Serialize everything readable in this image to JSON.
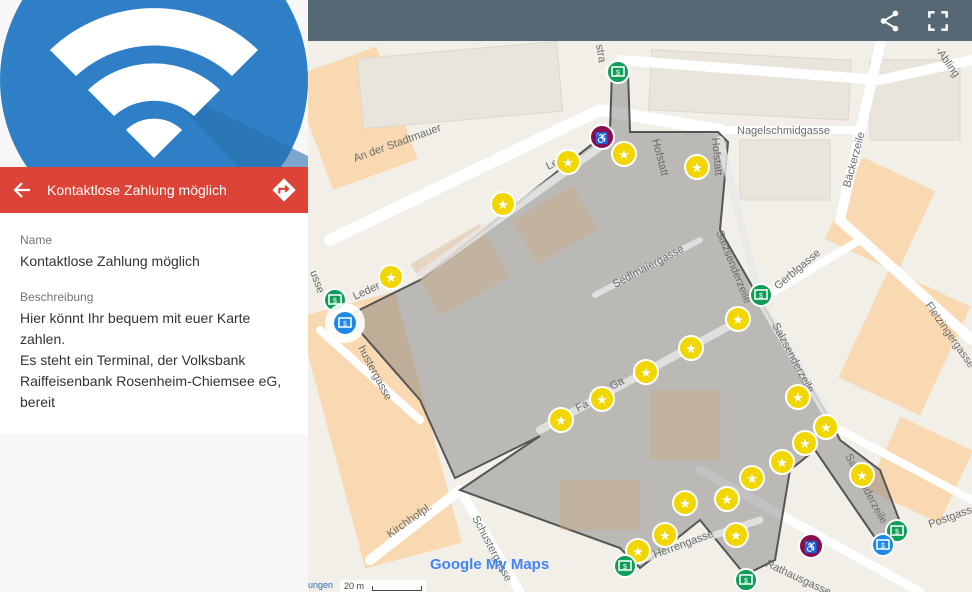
{
  "panel": {
    "title": "Kontaktlose Zahlung möglich",
    "name_label": "Name",
    "name_value": "Kontaktlose Zahlung möglich",
    "description_label": "Beschreibung",
    "description_lines": [
      "Hier könnt Ihr bequem mit euer Karte",
      "zahlen.",
      "Es steht ein Terminal, der Volksbank",
      "Raiffeisenbank Rosenheim-Chiemsee eG,",
      "bereit"
    ]
  },
  "map": {
    "streets": {
      "an_der_stadtmauer": "An der Stadtmauer",
      "nagelschmidgasse": "Nagelschmidgasse",
      "baeckerzeile": "Bäckerzeile",
      "hofstatt": "Hofstatt",
      "sedlmaiergasse": "Sedlmaiergasse",
      "salzsenderzeile": "Salzsenderzeile",
      "gerblgasse": "Gerblgasse",
      "fletzingergasse": "Fletzingergasse",
      "kirchhofpl": "Kirchhofpl.",
      "schustergasse": "Schustergasse",
      "herrengasse": "Herrengasse",
      "rathausgasse": "Rathausgasse",
      "postgasse": "Postgasse",
      "abling": "-Abling",
      "ledererzeile_partial": "Leder",
      "fall_partial": "Fa",
      "usse_partial": "usse",
      "ehustergasse": "hustergasse",
      "lederzeile_top": "Le",
      "gasse_partial": "Ga",
      "hofstatt2": "Hofstatt",
      "str_partial": "stra"
    },
    "logo_text": "Google My Maps",
    "scale_text": "20 m",
    "attribution": "ungen"
  },
  "colors": {
    "topbar": "#566873",
    "titlebar": "#db4437",
    "star_marker": "#f2d600",
    "bank_marker": "#0f9d58",
    "wc_marker": "#880e4f",
    "selected_marker": "#1e88e5"
  },
  "icons": {
    "share": "share-icon",
    "fullscreen": "fullscreen-icon",
    "back": "back-arrow-icon",
    "directions": "directions-icon",
    "star": "star-marker-icon",
    "bank": "dollar-marker-icon",
    "wc": "restroom-marker-icon"
  }
}
